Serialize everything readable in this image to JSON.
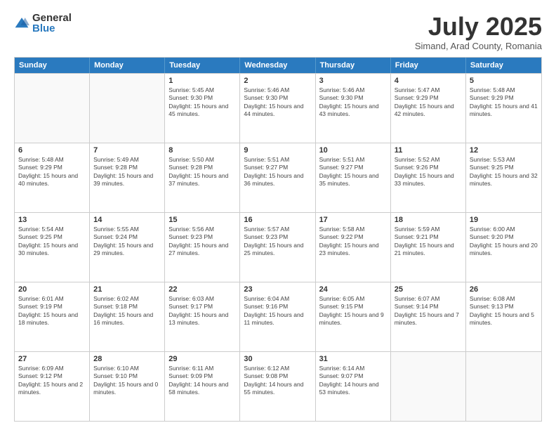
{
  "logo": {
    "general": "General",
    "blue": "Blue"
  },
  "header": {
    "month": "July 2025",
    "location": "Simand, Arad County, Romania"
  },
  "days": [
    "Sunday",
    "Monday",
    "Tuesday",
    "Wednesday",
    "Thursday",
    "Friday",
    "Saturday"
  ],
  "weeks": [
    [
      {
        "day": "",
        "info": ""
      },
      {
        "day": "",
        "info": ""
      },
      {
        "day": "1",
        "info": "Sunrise: 5:45 AM\nSunset: 9:30 PM\nDaylight: 15 hours and 45 minutes."
      },
      {
        "day": "2",
        "info": "Sunrise: 5:46 AM\nSunset: 9:30 PM\nDaylight: 15 hours and 44 minutes."
      },
      {
        "day": "3",
        "info": "Sunrise: 5:46 AM\nSunset: 9:30 PM\nDaylight: 15 hours and 43 minutes."
      },
      {
        "day": "4",
        "info": "Sunrise: 5:47 AM\nSunset: 9:29 PM\nDaylight: 15 hours and 42 minutes."
      },
      {
        "day": "5",
        "info": "Sunrise: 5:48 AM\nSunset: 9:29 PM\nDaylight: 15 hours and 41 minutes."
      }
    ],
    [
      {
        "day": "6",
        "info": "Sunrise: 5:48 AM\nSunset: 9:29 PM\nDaylight: 15 hours and 40 minutes."
      },
      {
        "day": "7",
        "info": "Sunrise: 5:49 AM\nSunset: 9:28 PM\nDaylight: 15 hours and 39 minutes."
      },
      {
        "day": "8",
        "info": "Sunrise: 5:50 AM\nSunset: 9:28 PM\nDaylight: 15 hours and 37 minutes."
      },
      {
        "day": "9",
        "info": "Sunrise: 5:51 AM\nSunset: 9:27 PM\nDaylight: 15 hours and 36 minutes."
      },
      {
        "day": "10",
        "info": "Sunrise: 5:51 AM\nSunset: 9:27 PM\nDaylight: 15 hours and 35 minutes."
      },
      {
        "day": "11",
        "info": "Sunrise: 5:52 AM\nSunset: 9:26 PM\nDaylight: 15 hours and 33 minutes."
      },
      {
        "day": "12",
        "info": "Sunrise: 5:53 AM\nSunset: 9:25 PM\nDaylight: 15 hours and 32 minutes."
      }
    ],
    [
      {
        "day": "13",
        "info": "Sunrise: 5:54 AM\nSunset: 9:25 PM\nDaylight: 15 hours and 30 minutes."
      },
      {
        "day": "14",
        "info": "Sunrise: 5:55 AM\nSunset: 9:24 PM\nDaylight: 15 hours and 29 minutes."
      },
      {
        "day": "15",
        "info": "Sunrise: 5:56 AM\nSunset: 9:23 PM\nDaylight: 15 hours and 27 minutes."
      },
      {
        "day": "16",
        "info": "Sunrise: 5:57 AM\nSunset: 9:23 PM\nDaylight: 15 hours and 25 minutes."
      },
      {
        "day": "17",
        "info": "Sunrise: 5:58 AM\nSunset: 9:22 PM\nDaylight: 15 hours and 23 minutes."
      },
      {
        "day": "18",
        "info": "Sunrise: 5:59 AM\nSunset: 9:21 PM\nDaylight: 15 hours and 21 minutes."
      },
      {
        "day": "19",
        "info": "Sunrise: 6:00 AM\nSunset: 9:20 PM\nDaylight: 15 hours and 20 minutes."
      }
    ],
    [
      {
        "day": "20",
        "info": "Sunrise: 6:01 AM\nSunset: 9:19 PM\nDaylight: 15 hours and 18 minutes."
      },
      {
        "day": "21",
        "info": "Sunrise: 6:02 AM\nSunset: 9:18 PM\nDaylight: 15 hours and 16 minutes."
      },
      {
        "day": "22",
        "info": "Sunrise: 6:03 AM\nSunset: 9:17 PM\nDaylight: 15 hours and 13 minutes."
      },
      {
        "day": "23",
        "info": "Sunrise: 6:04 AM\nSunset: 9:16 PM\nDaylight: 15 hours and 11 minutes."
      },
      {
        "day": "24",
        "info": "Sunrise: 6:05 AM\nSunset: 9:15 PM\nDaylight: 15 hours and 9 minutes."
      },
      {
        "day": "25",
        "info": "Sunrise: 6:07 AM\nSunset: 9:14 PM\nDaylight: 15 hours and 7 minutes."
      },
      {
        "day": "26",
        "info": "Sunrise: 6:08 AM\nSunset: 9:13 PM\nDaylight: 15 hours and 5 minutes."
      }
    ],
    [
      {
        "day": "27",
        "info": "Sunrise: 6:09 AM\nSunset: 9:12 PM\nDaylight: 15 hours and 2 minutes."
      },
      {
        "day": "28",
        "info": "Sunrise: 6:10 AM\nSunset: 9:10 PM\nDaylight: 15 hours and 0 minutes."
      },
      {
        "day": "29",
        "info": "Sunrise: 6:11 AM\nSunset: 9:09 PM\nDaylight: 14 hours and 58 minutes."
      },
      {
        "day": "30",
        "info": "Sunrise: 6:12 AM\nSunset: 9:08 PM\nDaylight: 14 hours and 55 minutes."
      },
      {
        "day": "31",
        "info": "Sunrise: 6:14 AM\nSunset: 9:07 PM\nDaylight: 14 hours and 53 minutes."
      },
      {
        "day": "",
        "info": ""
      },
      {
        "day": "",
        "info": ""
      }
    ]
  ]
}
